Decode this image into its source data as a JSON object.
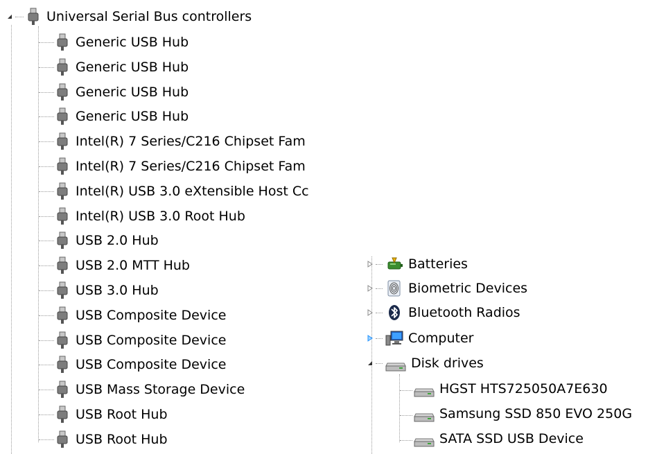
{
  "left_tree": {
    "category": {
      "label": "Universal Serial Bus controllers",
      "icon": "usb-connector-icon",
      "expanded": true
    },
    "items": [
      "Generic USB Hub",
      "Generic USB Hub",
      "Generic USB Hub",
      "Generic USB Hub",
      "Intel(R) 7 Series/C216 Chipset Fam",
      "Intel(R) 7 Series/C216 Chipset Fam",
      "Intel(R) USB 3.0 eXtensible Host Cc",
      "Intel(R) USB 3.0 Root Hub",
      "USB 2.0 Hub",
      "USB 2.0 MTT Hub",
      "USB 3.0 Hub",
      "USB Composite Device",
      "USB Composite Device",
      "USB Composite Device",
      "USB Mass Storage Device",
      "USB Root Hub",
      "USB Root Hub"
    ]
  },
  "right_tree": {
    "categories": [
      {
        "label": "Batteries",
        "icon": "battery-icon",
        "expanded": false
      },
      {
        "label": "Biometric Devices",
        "icon": "fingerprint-icon",
        "expanded": false
      },
      {
        "label": "Bluetooth Radios",
        "icon": "bluetooth-icon",
        "expanded": false
      },
      {
        "label": "Computer",
        "icon": "computer-icon",
        "expanded": false,
        "highlighted": true
      },
      {
        "label": "Disk drives",
        "icon": "disk-drive-icon",
        "expanded": true
      }
    ],
    "disk_drives": [
      "HGST HTS725050A7E630",
      "Samsung SSD 850 EVO 250G",
      "SATA SSD USB Device"
    ]
  },
  "colors": {
    "tree_line": "#9a9a9a",
    "highlight_arrow": "#1e90ff",
    "collapsed_arrow": "#888888"
  }
}
